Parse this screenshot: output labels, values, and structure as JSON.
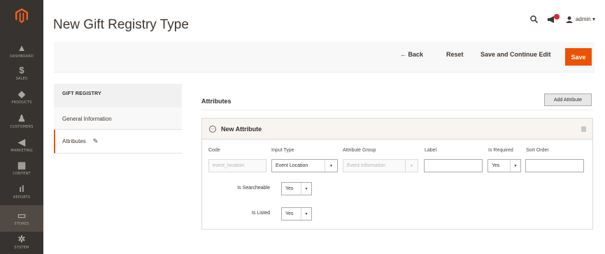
{
  "sidebar": {
    "items": [
      {
        "icon": "▲",
        "label": "DASHBOARD"
      },
      {
        "icon": "$",
        "label": "SALES"
      },
      {
        "icon": "◆",
        "label": "PRODUCTS"
      },
      {
        "icon": "♟",
        "label": "CUSTOMERS"
      },
      {
        "icon": "◀",
        "label": "MARKETING"
      },
      {
        "icon": "▦",
        "label": "CONTENT"
      },
      {
        "icon": "ıl",
        "label": "REPORTS"
      },
      {
        "icon": "▭",
        "label": "STORES"
      },
      {
        "icon": "✲",
        "label": "SYSTEM"
      }
    ]
  },
  "header": {
    "title": "New Gift Registry Type",
    "user": "admin ▾"
  },
  "actions": {
    "back": "← Back",
    "reset": "Reset",
    "save_continue": "Save and Continue Edit",
    "save": "Save"
  },
  "tabs": {
    "title": "GIFT REGISTRY",
    "general": "General Information",
    "attributes": "Attributes"
  },
  "main": {
    "title": "Attributes",
    "add_button": "Add Attribute",
    "fieldset_title": "New Attribute"
  },
  "columns": {
    "code": "Code",
    "input_type": "Input Type",
    "attribute_group": "Attribute Group",
    "label": "Label",
    "is_required": "Is Required",
    "sort_order": "Sort Order"
  },
  "values": {
    "code": "event_location",
    "input_type": "Event Location",
    "attribute_group": "Event Information",
    "label": "",
    "is_required": "Yes",
    "sort_order": ""
  },
  "options": {
    "is_searcheable_label": "Is Searcheable",
    "is_searcheable_value": "Yes",
    "is_listed_label": "Is Listed",
    "is_listed_value": "Yes"
  },
  "colors": {
    "sidebar": "#373330",
    "accent": "#eb5202"
  }
}
